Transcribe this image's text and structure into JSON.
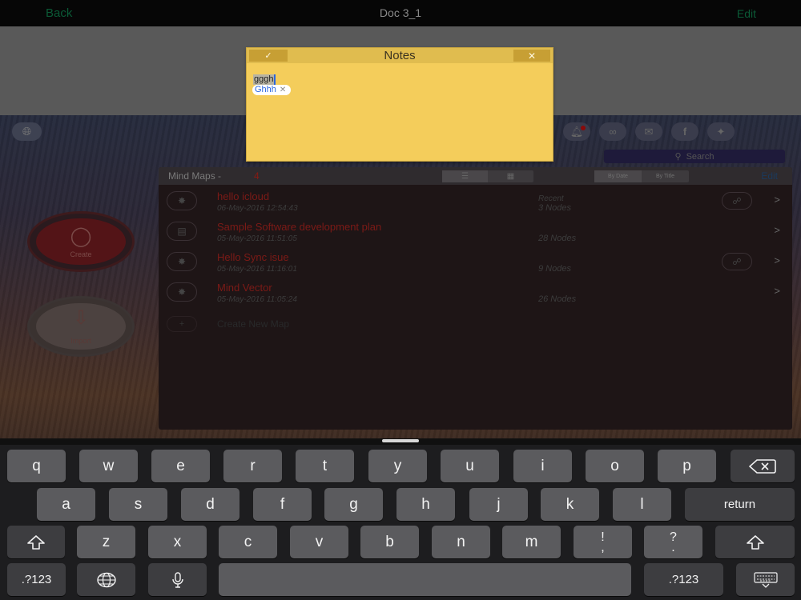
{
  "navbar": {
    "back": "Back",
    "title": "Doc 3_1",
    "edit": "Edit"
  },
  "toolbar": {
    "globe_icon": "globe-icon",
    "share_icons": [
      "notification-icon",
      "link-icon",
      "mail-icon",
      "facebook-icon",
      "twitter-icon"
    ],
    "search_placeholder": "Search"
  },
  "left_actions": {
    "create_label": "Create",
    "import_label": "Import"
  },
  "mindmaps": {
    "title": "Mind Maps -",
    "count": "4",
    "sort_by_date": "By Date",
    "sort_by_title": "By Title",
    "edit": "Edit",
    "rows": [
      {
        "name": "hello icloud",
        "date": "06-May-2016 12:54:43",
        "recent": "Recent",
        "nodes": "3 Nodes"
      },
      {
        "name": "Sample Software development plan",
        "date": "05-May-2016 11:51:05",
        "recent": "",
        "nodes": "28 Nodes"
      },
      {
        "name": "Hello Sync isue",
        "date": "05-May-2016 11:16:01",
        "recent": "",
        "nodes": "9 Nodes"
      },
      {
        "name": "Mind Vector",
        "date": "05-May-2016 11:05:24",
        "recent": "",
        "nodes": "26 Nodes"
      }
    ],
    "create_new": "Create New Map"
  },
  "notes": {
    "title": "Notes",
    "text": "gggh",
    "suggestion": "Ghhh"
  },
  "keyboard": {
    "row1": [
      "q",
      "w",
      "e",
      "r",
      "t",
      "y",
      "u",
      "i",
      "o",
      "p"
    ],
    "row2": [
      "a",
      "s",
      "d",
      "f",
      "g",
      "h",
      "j",
      "k",
      "l"
    ],
    "row3": [
      "z",
      "x",
      "c",
      "v",
      "b",
      "n",
      "m"
    ],
    "punct1_top": "!",
    "punct1_bottom": ",",
    "punct2_top": "?",
    "punct2_bottom": ".",
    "return": "return",
    "numbers_left": ".?123",
    "numbers_right": ".?123"
  }
}
